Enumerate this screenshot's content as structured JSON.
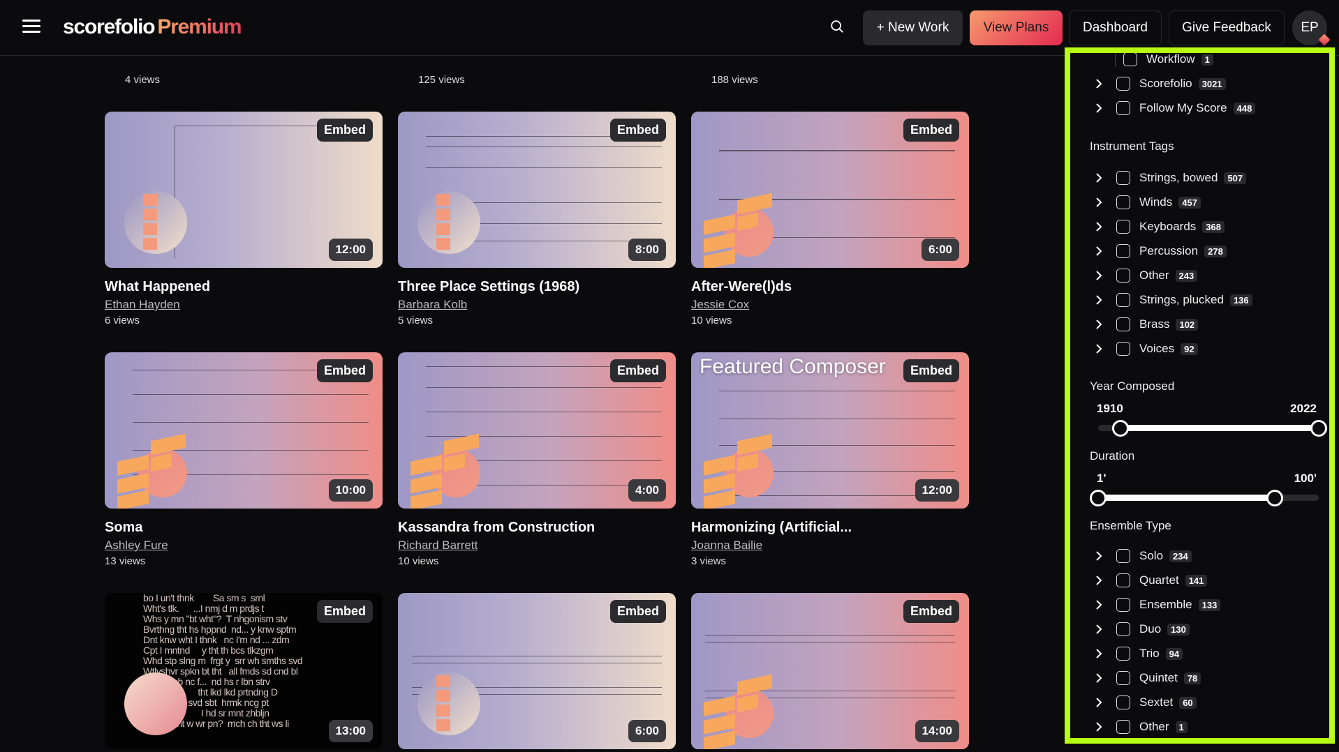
{
  "header": {
    "brand": "scorefolio",
    "brand_suffix": "Premium",
    "new_work": "+ New Work",
    "view_plans": "View Plans",
    "dashboard": "Dashboard",
    "give_feedback": "Give Feedback",
    "avatar_initials": "EP"
  },
  "top_row_views": [
    "4 views",
    "125 views",
    "188 views"
  ],
  "cards": [
    {
      "title": "What Happened",
      "author": "Ethan Hayden",
      "views": "6 views",
      "duration": "12:00",
      "embed": "Embed"
    },
    {
      "title": "Three Place Settings (1968)",
      "author": "Barbara Kolb",
      "views": "5 views",
      "duration": "8:00",
      "embed": "Embed"
    },
    {
      "title": "After-Were(l)ds",
      "author": "Jessie Cox",
      "views": "10 views",
      "duration": "6:00",
      "embed": "Embed"
    },
    {
      "title": "Soma",
      "author": "Ashley Fure",
      "views": "13 views",
      "duration": "10:00",
      "embed": "Embed"
    },
    {
      "title": "Kassandra from Construction",
      "author": "Richard Barrett",
      "views": "10 views",
      "duration": "4:00",
      "embed": "Embed"
    },
    {
      "title": "Harmonizing (Artificial...",
      "author": "Joanna Bailie",
      "views": "3 views",
      "duration": "12:00",
      "embed": "Embed",
      "overlay": "Featured Composer"
    },
    {
      "duration": "13:00",
      "embed": "Embed"
    },
    {
      "duration": "6:00",
      "embed": "Embed"
    },
    {
      "duration": "14:00",
      "embed": "Embed"
    }
  ],
  "sidebar": {
    "partial_item": {
      "label": "Workflow",
      "count": "1"
    },
    "source_items": [
      {
        "label": "Scorefolio",
        "count": "3021"
      },
      {
        "label": "Follow My Score",
        "count": "448"
      }
    ],
    "instrument_title": "Instrument Tags",
    "instruments": [
      {
        "label": "Strings, bowed",
        "count": "507"
      },
      {
        "label": "Winds",
        "count": "457"
      },
      {
        "label": "Keyboards",
        "count": "368"
      },
      {
        "label": "Percussion",
        "count": "278"
      },
      {
        "label": "Other",
        "count": "243"
      },
      {
        "label": "Strings, plucked",
        "count": "136"
      },
      {
        "label": "Brass",
        "count": "102"
      },
      {
        "label": "Voices",
        "count": "92"
      }
    ],
    "year": {
      "title": "Year Composed",
      "min_label": "1910",
      "max_label": "2022",
      "low_frac": 0.1,
      "high_frac": 1.0
    },
    "duration": {
      "title": "Duration",
      "min_label": "1'",
      "max_label": "100'",
      "low_frac": 0.0,
      "high_frac": 0.8
    },
    "ensemble_title": "Ensemble Type",
    "ensembles": [
      {
        "label": "Solo",
        "count": "234"
      },
      {
        "label": "Quartet",
        "count": "141"
      },
      {
        "label": "Ensemble",
        "count": "133"
      },
      {
        "label": "Duo",
        "count": "130"
      },
      {
        "label": "Trio",
        "count": "94"
      },
      {
        "label": "Quintet",
        "count": "78"
      },
      {
        "label": "Sextet",
        "count": "60"
      },
      {
        "label": "Other",
        "count": "1"
      }
    ]
  },
  "colors": {
    "accent_start": "#f59a6d",
    "accent_end": "#e52a52",
    "highlight": "#b8ff12"
  }
}
